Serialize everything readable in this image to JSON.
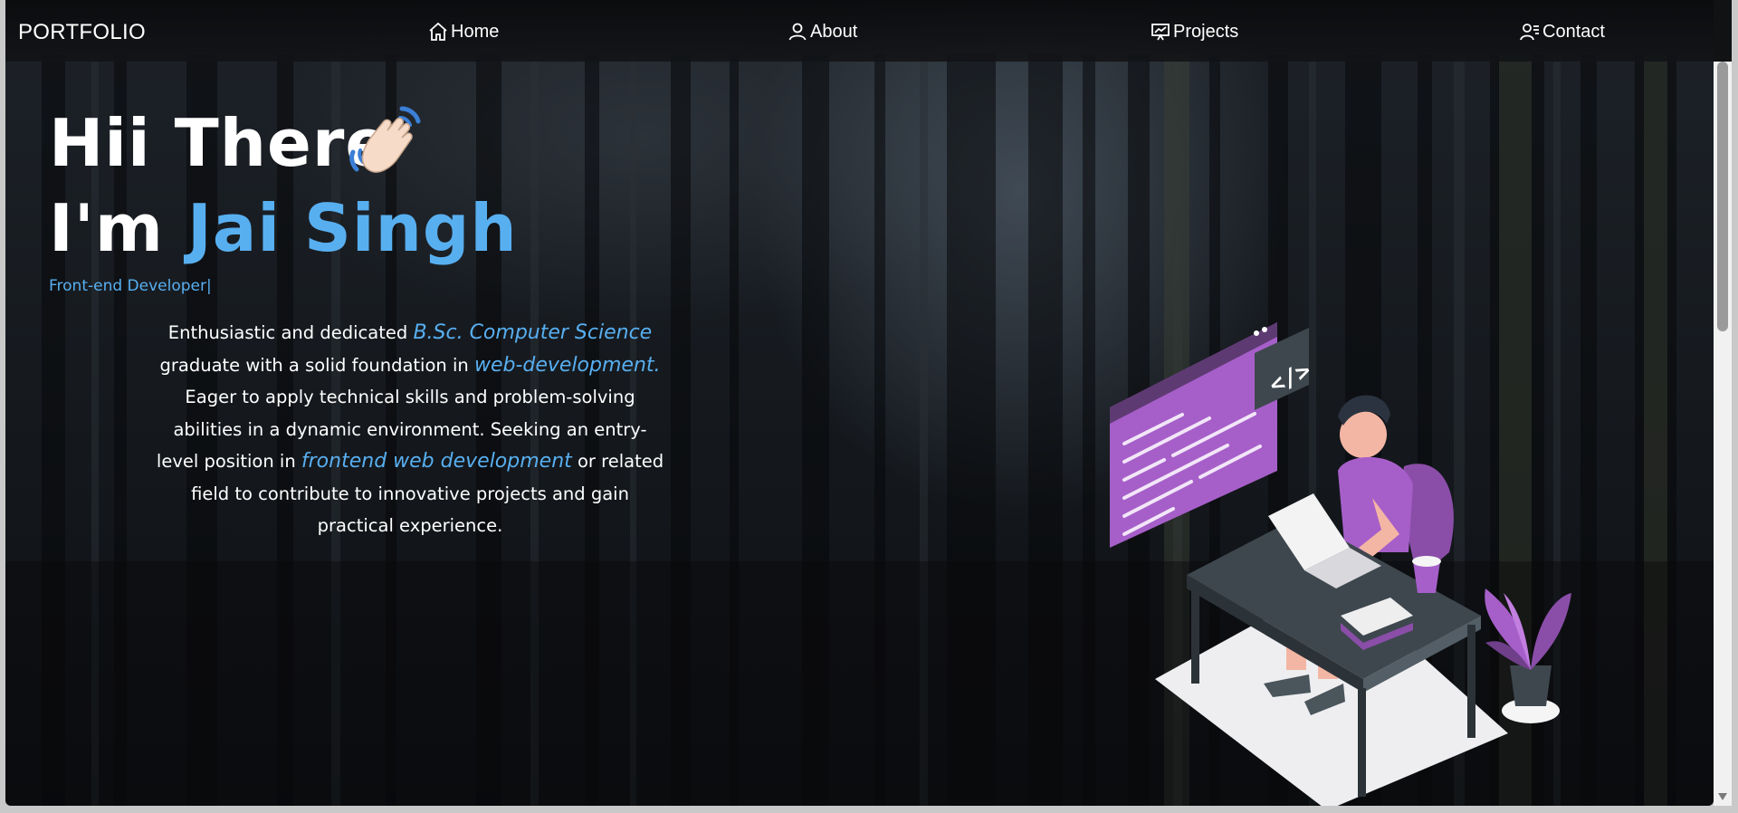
{
  "navbar": {
    "brand": "PORTFOLIO",
    "items": [
      {
        "label": "Home",
        "icon": "home-icon"
      },
      {
        "label": "About",
        "icon": "user-icon"
      },
      {
        "label": "Projects",
        "icon": "presentation-chart-icon"
      },
      {
        "label": "Contact",
        "icon": "user-contact-icon"
      }
    ]
  },
  "hero": {
    "greeting": "Hii There",
    "greeting_emoji": "waving-hand-icon",
    "intro_prefix": "I'm",
    "name": "Jai Singh",
    "role": "Front-end Developer",
    "role_cursor": "|",
    "bio": {
      "t1": "Enthusiastic and dedicated ",
      "h1": "B.Sc. Computer Science",
      "t2": " graduate with a solid foundation in ",
      "h2": "web-development.",
      "t3": " Eager to apply technical skills and problem-solving abilities in a dynamic environment. Seeking an entry-level position in ",
      "h3": "frontend web development",
      "t4": " or related field to contribute to innovative projects and gain practical experience."
    }
  },
  "colors": {
    "accent": "#58aff0",
    "text": "#ffffff",
    "navbar_bg": "#0b0c0e",
    "illustration_purple": "#a65fc9"
  }
}
